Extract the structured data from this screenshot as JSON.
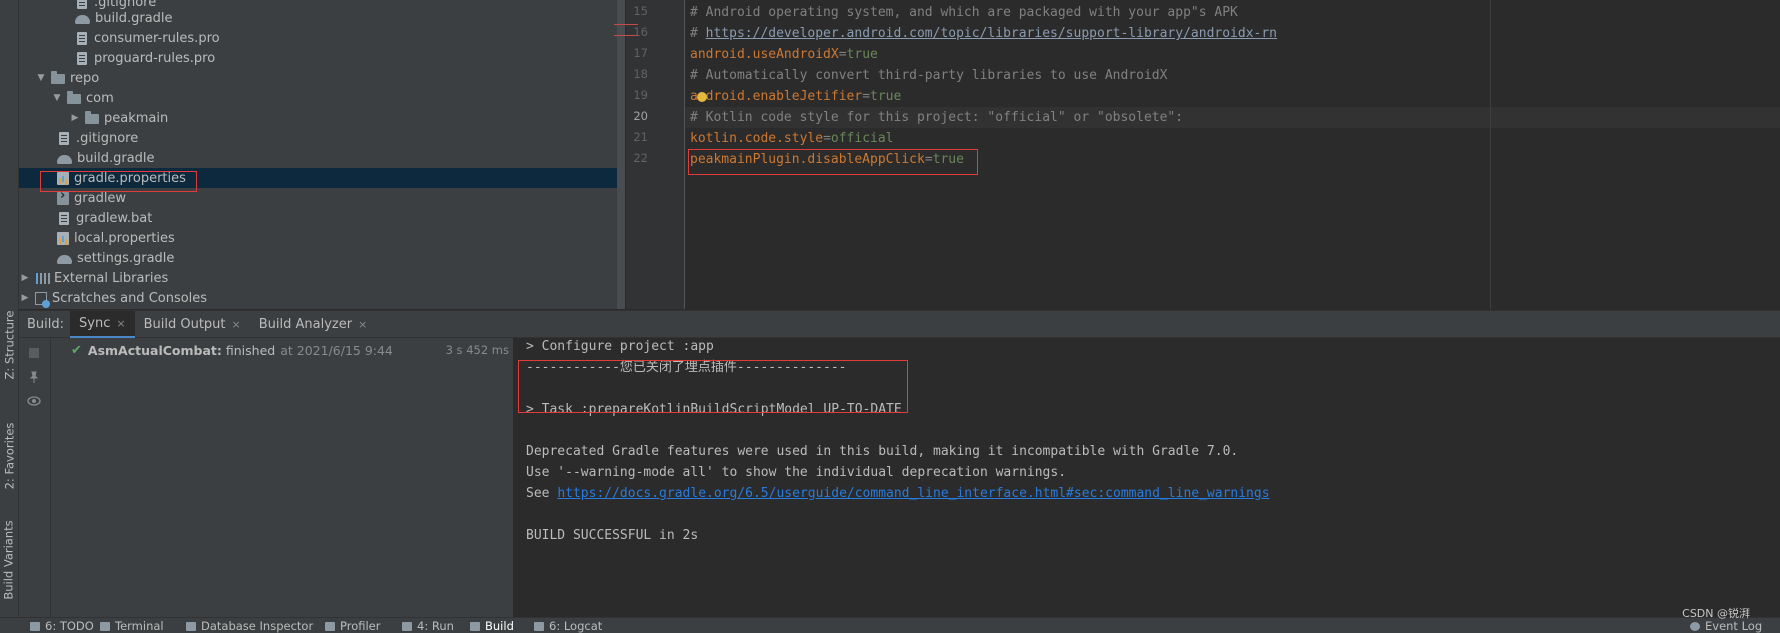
{
  "left_strip": {
    "tabs": [
      "Z: Structure",
      "2: Favorites",
      "Build Variants"
    ]
  },
  "project_tree": {
    "items": [
      {
        "label": ".gitignore",
        "icon": "gitignore-file-icon"
      },
      {
        "label": "build.gradle",
        "icon": "gradle-icon"
      },
      {
        "label": "consumer-rules.pro",
        "icon": "text-file-icon"
      },
      {
        "label": "proguard-rules.pro",
        "icon": "text-file-icon"
      },
      {
        "label": "repo",
        "icon": "folder-icon"
      },
      {
        "label": "com",
        "icon": "folder-icon"
      },
      {
        "label": "peakmain",
        "icon": "folder-icon"
      },
      {
        "label": ".gitignore",
        "icon": "gitignore-file-icon"
      },
      {
        "label": "build.gradle",
        "icon": "gradle-icon"
      },
      {
        "label": "gradle.properties",
        "icon": "properties-file-icon"
      },
      {
        "label": "gradlew",
        "icon": "script-file-icon"
      },
      {
        "label": "gradlew.bat",
        "icon": "text-file-icon"
      },
      {
        "label": "local.properties",
        "icon": "properties-file-icon"
      },
      {
        "label": "settings.gradle",
        "icon": "gradle-icon"
      },
      {
        "label": "External Libraries",
        "icon": "library-icon"
      },
      {
        "label": "Scratches and Consoles",
        "icon": "scratch-icon"
      }
    ]
  },
  "editor": {
    "line_numbers": [
      "15",
      "16",
      "17",
      "18",
      "19",
      "20",
      "21",
      "22"
    ],
    "current_line": "20",
    "lines": [
      {
        "comment": "# Android operating system, and which are packaged with your app\"s APK"
      },
      {
        "prefix": "# ",
        "link": "https://developer.android.com/topic/libraries/support-library/androidx-rn"
      },
      {
        "key": "android.useAndroidX",
        "eq": "=",
        "value": "true"
      },
      {
        "comment": "# Automatically convert third-party libraries to use AndroidX"
      },
      {
        "key": "android.enableJetifier",
        "eq": "=",
        "value": "true"
      },
      {
        "comment": "# Kotlin code style for this project: \"official\" or \"obsolete\":"
      },
      {
        "key": "kotlin.code.style",
        "eq": "=",
        "value": "official"
      },
      {
        "key": "peakmainPlugin.disableAppClick",
        "eq": "=",
        "value": "true"
      }
    ]
  },
  "build_panel": {
    "prefix": "Build:",
    "tabs": [
      {
        "label": "Sync",
        "active": true
      },
      {
        "label": "Build Output",
        "active": false
      },
      {
        "label": "Build Analyzer",
        "active": false
      }
    ],
    "close_glyph": "×",
    "result": {
      "project": "AsmActualCombat:",
      "status": "finished",
      "time": "at 2021/6/15 9:44",
      "duration": "3 s 452 ms"
    },
    "console": {
      "line1": "> Configure project :app",
      "line2": "------------您已关闭了埋点插件--------------",
      "line3": "> Task :prepareKotlinBuildScriptModel UP-TO-DATE",
      "line4": "Deprecated Gradle features were used in this build, making it incompatible with Gradle 7.0.",
      "line5": "Use '--warning-mode all' to show the individual deprecation warnings.",
      "line6_prefix": "See ",
      "line6_link": "https://docs.gradle.org/6.5/userguide/command_line_interface.html#sec:command_line_warnings",
      "line7": "BUILD SUCCESSFUL in 2s"
    }
  },
  "bottom_bar": {
    "items": [
      {
        "label": "6: TODO",
        "active": false
      },
      {
        "label": "Terminal",
        "active": false
      },
      {
        "label": "Database Inspector",
        "active": false
      },
      {
        "label": "Profiler",
        "active": false
      },
      {
        "label": "4: Run",
        "active": false
      },
      {
        "label": "Build",
        "active": true
      },
      {
        "label": "6: Logcat",
        "active": false
      }
    ],
    "right_item": "Event Log"
  },
  "watermark": "CSDN @锐湃",
  "colors": {
    "accent_blue": "#4a88c7",
    "annotation_red": "#e23b3b",
    "success_green": "#59a869",
    "keyword_orange": "#cc7832",
    "value_green": "#6a8759"
  }
}
